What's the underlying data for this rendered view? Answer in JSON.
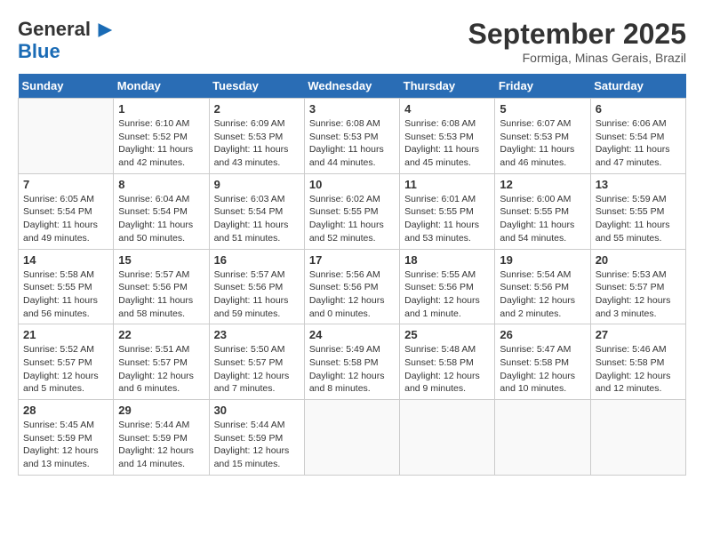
{
  "header": {
    "logo_line1": "General",
    "logo_line2": "Blue",
    "month": "September 2025",
    "location": "Formiga, Minas Gerais, Brazil"
  },
  "weekdays": [
    "Sunday",
    "Monday",
    "Tuesday",
    "Wednesday",
    "Thursday",
    "Friday",
    "Saturday"
  ],
  "weeks": [
    [
      {
        "day": "",
        "sunrise": "",
        "sunset": "",
        "daylight": ""
      },
      {
        "day": "1",
        "sunrise": "6:10 AM",
        "sunset": "5:52 PM",
        "daylight": "11 hours and 42 minutes."
      },
      {
        "day": "2",
        "sunrise": "6:09 AM",
        "sunset": "5:53 PM",
        "daylight": "11 hours and 43 minutes."
      },
      {
        "day": "3",
        "sunrise": "6:08 AM",
        "sunset": "5:53 PM",
        "daylight": "11 hours and 44 minutes."
      },
      {
        "day": "4",
        "sunrise": "6:08 AM",
        "sunset": "5:53 PM",
        "daylight": "11 hours and 45 minutes."
      },
      {
        "day": "5",
        "sunrise": "6:07 AM",
        "sunset": "5:53 PM",
        "daylight": "11 hours and 46 minutes."
      },
      {
        "day": "6",
        "sunrise": "6:06 AM",
        "sunset": "5:54 PM",
        "daylight": "11 hours and 47 minutes."
      }
    ],
    [
      {
        "day": "7",
        "sunrise": "6:05 AM",
        "sunset": "5:54 PM",
        "daylight": "11 hours and 49 minutes."
      },
      {
        "day": "8",
        "sunrise": "6:04 AM",
        "sunset": "5:54 PM",
        "daylight": "11 hours and 50 minutes."
      },
      {
        "day": "9",
        "sunrise": "6:03 AM",
        "sunset": "5:54 PM",
        "daylight": "11 hours and 51 minutes."
      },
      {
        "day": "10",
        "sunrise": "6:02 AM",
        "sunset": "5:55 PM",
        "daylight": "11 hours and 52 minutes."
      },
      {
        "day": "11",
        "sunrise": "6:01 AM",
        "sunset": "5:55 PM",
        "daylight": "11 hours and 53 minutes."
      },
      {
        "day": "12",
        "sunrise": "6:00 AM",
        "sunset": "5:55 PM",
        "daylight": "11 hours and 54 minutes."
      },
      {
        "day": "13",
        "sunrise": "5:59 AM",
        "sunset": "5:55 PM",
        "daylight": "11 hours and 55 minutes."
      }
    ],
    [
      {
        "day": "14",
        "sunrise": "5:58 AM",
        "sunset": "5:55 PM",
        "daylight": "11 hours and 56 minutes."
      },
      {
        "day": "15",
        "sunrise": "5:57 AM",
        "sunset": "5:56 PM",
        "daylight": "11 hours and 58 minutes."
      },
      {
        "day": "16",
        "sunrise": "5:57 AM",
        "sunset": "5:56 PM",
        "daylight": "11 hours and 59 minutes."
      },
      {
        "day": "17",
        "sunrise": "5:56 AM",
        "sunset": "5:56 PM",
        "daylight": "12 hours and 0 minutes."
      },
      {
        "day": "18",
        "sunrise": "5:55 AM",
        "sunset": "5:56 PM",
        "daylight": "12 hours and 1 minute."
      },
      {
        "day": "19",
        "sunrise": "5:54 AM",
        "sunset": "5:56 PM",
        "daylight": "12 hours and 2 minutes."
      },
      {
        "day": "20",
        "sunrise": "5:53 AM",
        "sunset": "5:57 PM",
        "daylight": "12 hours and 3 minutes."
      }
    ],
    [
      {
        "day": "21",
        "sunrise": "5:52 AM",
        "sunset": "5:57 PM",
        "daylight": "12 hours and 5 minutes."
      },
      {
        "day": "22",
        "sunrise": "5:51 AM",
        "sunset": "5:57 PM",
        "daylight": "12 hours and 6 minutes."
      },
      {
        "day": "23",
        "sunrise": "5:50 AM",
        "sunset": "5:57 PM",
        "daylight": "12 hours and 7 minutes."
      },
      {
        "day": "24",
        "sunrise": "5:49 AM",
        "sunset": "5:58 PM",
        "daylight": "12 hours and 8 minutes."
      },
      {
        "day": "25",
        "sunrise": "5:48 AM",
        "sunset": "5:58 PM",
        "daylight": "12 hours and 9 minutes."
      },
      {
        "day": "26",
        "sunrise": "5:47 AM",
        "sunset": "5:58 PM",
        "daylight": "12 hours and 10 minutes."
      },
      {
        "day": "27",
        "sunrise": "5:46 AM",
        "sunset": "5:58 PM",
        "daylight": "12 hours and 12 minutes."
      }
    ],
    [
      {
        "day": "28",
        "sunrise": "5:45 AM",
        "sunset": "5:59 PM",
        "daylight": "12 hours and 13 minutes."
      },
      {
        "day": "29",
        "sunrise": "5:44 AM",
        "sunset": "5:59 PM",
        "daylight": "12 hours and 14 minutes."
      },
      {
        "day": "30",
        "sunrise": "5:44 AM",
        "sunset": "5:59 PM",
        "daylight": "12 hours and 15 minutes."
      },
      {
        "day": "",
        "sunrise": "",
        "sunset": "",
        "daylight": ""
      },
      {
        "day": "",
        "sunrise": "",
        "sunset": "",
        "daylight": ""
      },
      {
        "day": "",
        "sunrise": "",
        "sunset": "",
        "daylight": ""
      },
      {
        "day": "",
        "sunrise": "",
        "sunset": "",
        "daylight": ""
      }
    ]
  ]
}
